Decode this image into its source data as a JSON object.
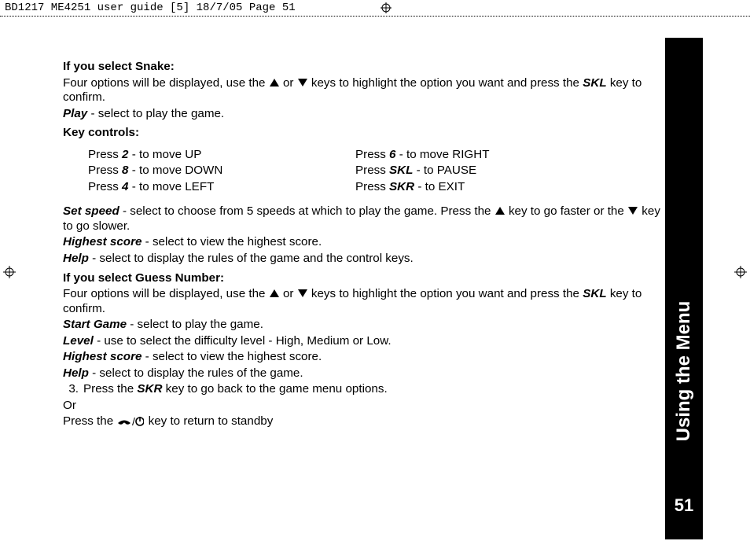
{
  "crop": {
    "header": "BD1217 ME4251 user guide [5]  18/7/05   Page 51"
  },
  "sidebar": {
    "tab": "Using the Menu",
    "page_number": "51"
  },
  "body": {
    "snake_heading": "If you select Snake:",
    "snake_intro_pre": "Four options will be displayed, use the ",
    "snake_intro_mid": " or ",
    "snake_intro_post": " keys to highlight the option you want and press the ",
    "skl": "SKL",
    "snake_intro_end": " key to confirm.",
    "play_label": "Play",
    "play_text": "  -  select to play the game.",
    "key_controls": "Key controls:",
    "controls_left": [
      {
        "pre": "Press ",
        "key": "2",
        "post": " -  to move UP"
      },
      {
        "pre": "Press ",
        "key": "8",
        "post": " -  to move DOWN"
      },
      {
        "pre": "Press ",
        "key": "4",
        "post": " -  to  move LEFT"
      }
    ],
    "controls_right": [
      {
        "pre": "Press ",
        "key": "6",
        "post": " -  to move RIGHT"
      },
      {
        "pre": "Press ",
        "key": "SKL",
        "post": " -  to PAUSE"
      },
      {
        "pre": "Press ",
        "key": "SKR",
        "post": " -  to EXIT"
      }
    ],
    "set_speed_label": "Set speed",
    "set_speed_pre": " -  select to choose from 5 speeds at which to play the game. Press the ",
    "set_speed_mid": " key to go faster or the ",
    "set_speed_end": " key to go slower.",
    "highest_score_label": "Highest score",
    "highest_score_text": " -  select to view the highest score.",
    "help_label": "Help",
    "help_text": " -  select to display the rules of the game and the control keys.",
    "guess_heading": "If you select Guess Number:",
    "guess_intro_pre": "Four options will be displayed, use the ",
    "guess_intro_mid": " or ",
    "guess_intro_post": " keys to highlight the option you want and press the ",
    "guess_intro_end": " key to confirm.",
    "start_game_label": "Start Game",
    "start_game_text": " -  select to play the game.",
    "level_label": "Level",
    "level_text": " -  use to select the difficulty level - High, Medium or Low.",
    "guess_highscore_label": "Highest score",
    "guess_highscore_text": " -  select to view the highest score.",
    "guess_help_label": "Help",
    "guess_help_text": " -  select to display the rules of the game.",
    "step3_num": "3.",
    "step3_pre": "Press the ",
    "skr": "SKR",
    "step3_post": " key to go back to the game menu options.",
    "or": "Or",
    "standby_pre": "Press the ",
    "standby_post": " key to return to standby"
  }
}
